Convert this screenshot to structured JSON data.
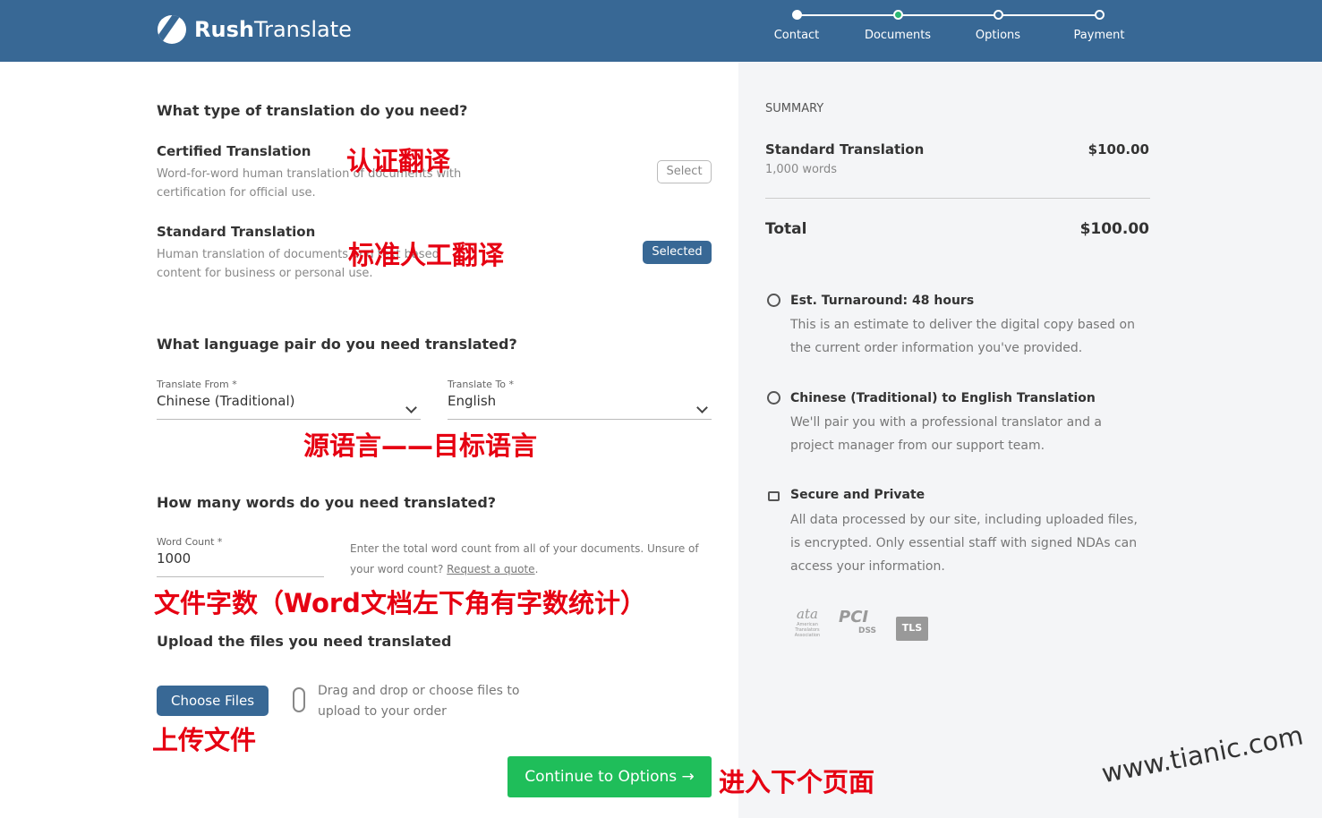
{
  "header": {
    "logo_bold": "Rush",
    "logo_rest": "Translate",
    "steps": [
      {
        "label": "Contact",
        "state": "done"
      },
      {
        "label": "Documents",
        "state": "current"
      },
      {
        "label": "Options",
        "state": "todo"
      },
      {
        "label": "Payment",
        "state": "todo"
      }
    ]
  },
  "type_section": {
    "title": "What type of translation do you need?",
    "options": [
      {
        "name": "Certified Translation",
        "desc": "Word-for-word human translation of documents with certification for official use.",
        "button": "Select"
      },
      {
        "name": "Standard Translation",
        "desc": "Human translation of documents and text based content for business or personal use.",
        "button": "Selected"
      }
    ]
  },
  "language_section": {
    "title": "What language pair do you need translated?",
    "from_label": "Translate From *",
    "from_value": "Chinese (Traditional)",
    "to_label": "Translate To *",
    "to_value": "English"
  },
  "words_section": {
    "title": "How many words do you need translated?",
    "label": "Word Count *",
    "value": "1000",
    "help": "Enter the total word count from all of your documents. Unsure of your word count?",
    "help_link": "Request a quote",
    "help_end": "."
  },
  "upload_section": {
    "title": "Upload the files you need translated",
    "button": "Choose Files",
    "hint": "Drag and drop or choose files to upload to your order"
  },
  "continue_button": "Continue to Options →",
  "annotations": {
    "certified": "认证翻译",
    "standard": "标准人工翻译",
    "languages": "源语言——目标语言",
    "words": "文件字数（Word文档左下角有字数统计）",
    "upload": "上传文件",
    "next": "进入下个页面"
  },
  "watermark": "www.tianic.com",
  "summary": {
    "heading": "SUMMARY",
    "item": "Standard Translation",
    "item_price": "$100.00",
    "item_words": "1,000 words",
    "total_label": "Total",
    "total": "$100.00",
    "info": [
      {
        "icon": "stopwatch-icon",
        "title": "Est. Turnaround: 48 hours",
        "desc": "This is an estimate to deliver the digital copy based on the current order information you've provided."
      },
      {
        "icon": "globe-icon",
        "title": "Chinese (Traditional) to English Translation",
        "desc": "We'll pair you with a professional translator and a project manager from our support team."
      },
      {
        "icon": "lock-icon",
        "title": "Secure and Private",
        "desc": "All data processed by our site, including uploaded files, is encrypted. Only essential staff with signed NDAs can access your information."
      }
    ],
    "badges": [
      "ata American Translators Association",
      "PCI DSS",
      "TLS"
    ]
  },
  "colors": {
    "header": "#386895",
    "accent_green": "#1fbe5a",
    "annotation_red": "#e60012"
  }
}
